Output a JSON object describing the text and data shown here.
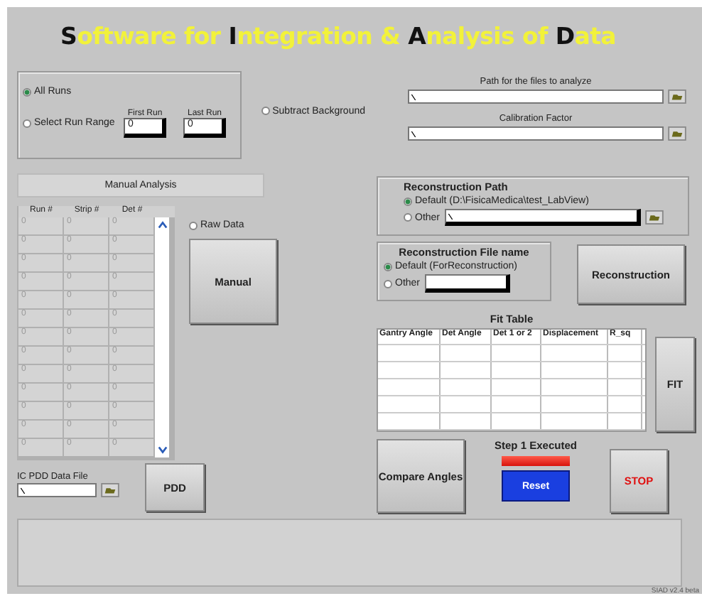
{
  "title": [
    {
      "text": "S",
      "emphasis": true
    },
    {
      "text": "oftware for ",
      "emphasis": false
    },
    {
      "text": "I",
      "emphasis": true
    },
    {
      "text": "ntegration & ",
      "emphasis": false
    },
    {
      "text": "A",
      "emphasis": true
    },
    {
      "text": "nalysis of ",
      "emphasis": false
    },
    {
      "text": "D",
      "emphasis": true
    },
    {
      "text": "ata",
      "emphasis": false
    }
  ],
  "run_selection": {
    "options": [
      {
        "label": "All Runs",
        "selected": true
      },
      {
        "label": "Select Run Range",
        "selected": false
      }
    ],
    "first_run": {
      "label": "First Run",
      "value": "0"
    },
    "last_run": {
      "label": "Last Run",
      "value": "0"
    }
  },
  "subtract_background": {
    "label": "Subtract Background",
    "checked": false
  },
  "path_files": {
    "label": "Path for the files to analyze"
  },
  "calibration_factor": {
    "label": "Calibration Factor"
  },
  "manual_analysis": {
    "label": "Manual Analysis"
  },
  "run_table": {
    "columns": [
      "Run #",
      "Strip #",
      "Det #"
    ],
    "rows": [
      [
        "0",
        "0",
        "0"
      ],
      [
        "0",
        "0",
        "0"
      ],
      [
        "0",
        "0",
        "0"
      ],
      [
        "0",
        "0",
        "0"
      ],
      [
        "0",
        "0",
        "0"
      ],
      [
        "0",
        "0",
        "0"
      ],
      [
        "0",
        "0",
        "0"
      ],
      [
        "0",
        "0",
        "0"
      ],
      [
        "0",
        "0",
        "0"
      ],
      [
        "0",
        "0",
        "0"
      ],
      [
        "0",
        "0",
        "0"
      ],
      [
        "0",
        "0",
        "0"
      ],
      [
        "0",
        "0",
        "0"
      ]
    ]
  },
  "raw_data": {
    "label": "Raw Data",
    "checked": false
  },
  "manual_button": "Manual",
  "pdd_file": {
    "label": "IC PDD Data File"
  },
  "pdd_button": "PDD",
  "reconstruction_path": {
    "title": "Reconstruction Path",
    "options": [
      {
        "label": "Default (D:\\FisicaMedica\\test_LabView)",
        "selected": true
      },
      {
        "label": "Other",
        "selected": false
      }
    ]
  },
  "reconstruction_file": {
    "title": "Reconstruction File name",
    "options": [
      {
        "label": "Default (ForReconstruction)",
        "selected": true
      },
      {
        "label": "Other",
        "selected": false
      }
    ]
  },
  "reconstruction_button": "Reconstruction",
  "fit_table": {
    "title": "Fit Table",
    "columns": [
      "Gantry Angle",
      "Det Angle",
      "Det 1 or 2",
      "Displacement",
      "R_sq"
    ]
  },
  "fit_button": "FIT",
  "compare_button": "Compare Angles",
  "step1": {
    "label": "Step 1 Executed",
    "on": true
  },
  "reset_button": "Reset",
  "stop_button": "STOP",
  "version": "SIAD v2.4 beta"
}
